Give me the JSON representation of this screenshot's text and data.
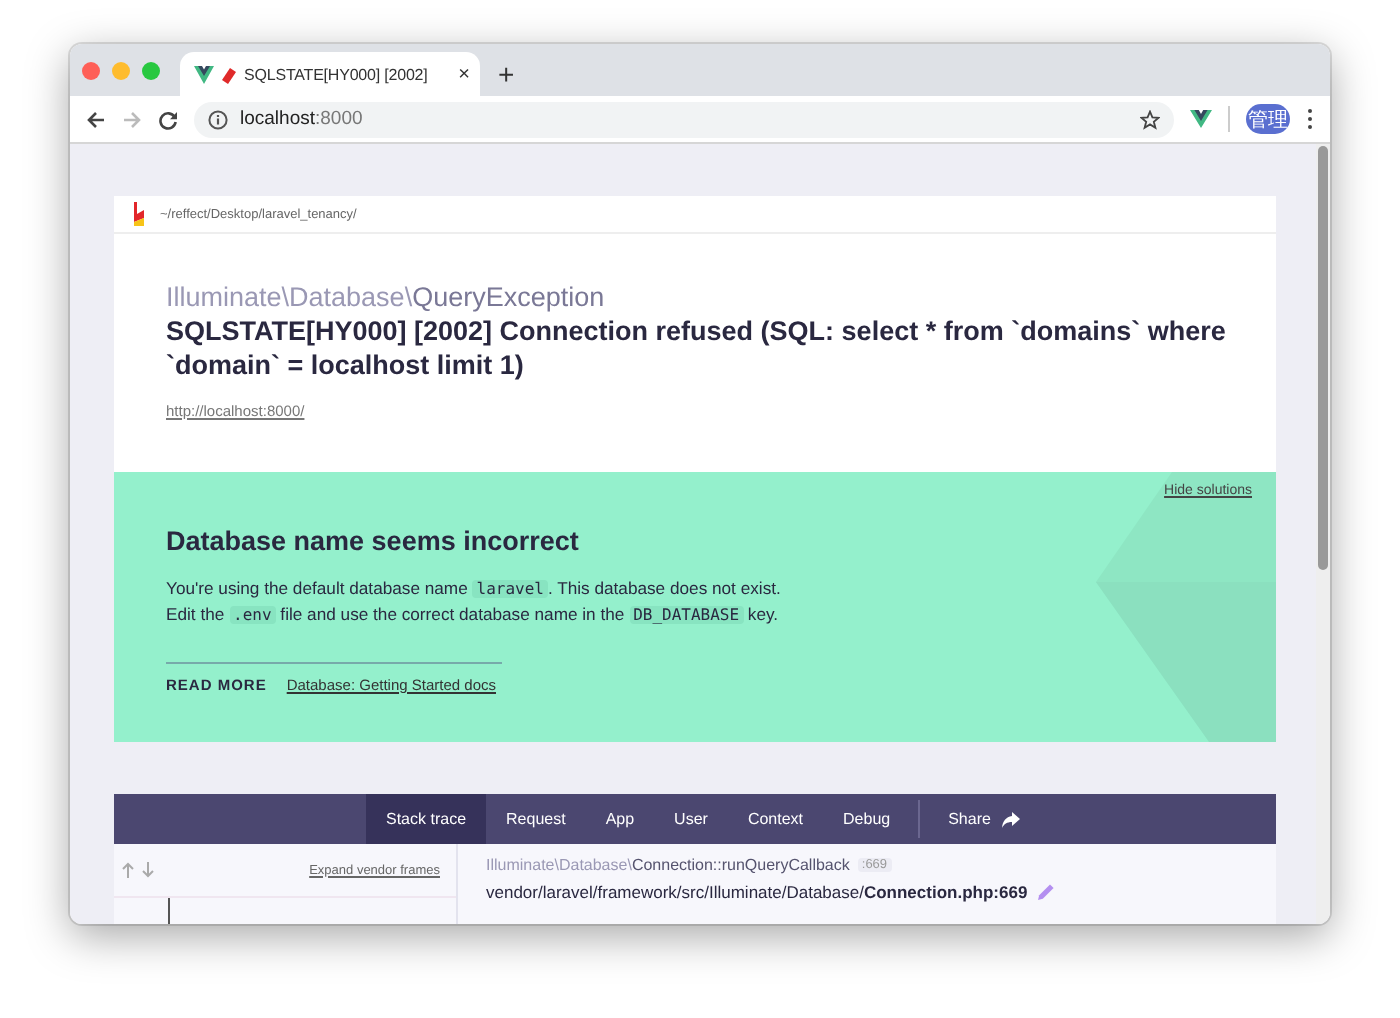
{
  "browser": {
    "tab": {
      "title": "SQLSTATE[HY000] [2002]",
      "close": "×"
    },
    "new_tab": "+",
    "back_disabled": false,
    "forward_disabled": true,
    "address": {
      "host": "localhost",
      "port": ":8000"
    },
    "avatar": "管理"
  },
  "error": {
    "path": "~/reffect/Desktop/laravel_tenancy/",
    "exception": {
      "namespace": "Illuminate\\Database\\",
      "class": "QueryException"
    },
    "message": "SQLSTATE[HY000] [2002] Connection refused (SQL: select * from `domains` where `domain` = localhost limit 1)",
    "url": "http://localhost:8000/"
  },
  "solution": {
    "hide_label": "Hide solutions",
    "title": "Database name seems incorrect",
    "lines": [
      [
        {
          "kind": "text",
          "text": "You're using the default database name "
        },
        {
          "kind": "code",
          "text": "laravel"
        },
        {
          "kind": "text",
          "text": ". This database does not exist."
        }
      ],
      [
        {
          "kind": "text",
          "text": "Edit the "
        },
        {
          "kind": "code",
          "text": ".env"
        },
        {
          "kind": "text",
          "text": " file and use the correct database name in the "
        },
        {
          "kind": "code",
          "text": "DB_DATABASE"
        },
        {
          "kind": "text",
          "text": " key."
        }
      ]
    ],
    "read_more": {
      "label": "READ MORE",
      "links": [
        "Database: Getting Started docs"
      ]
    }
  },
  "trace": {
    "tabs": [
      {
        "label": "Stack trace",
        "kind": "tab",
        "selected": true
      },
      {
        "label": "Request",
        "kind": "tab",
        "selected": false
      },
      {
        "label": "App",
        "kind": "tab",
        "selected": false
      },
      {
        "label": "User",
        "kind": "tab",
        "selected": false
      },
      {
        "label": "Context",
        "kind": "tab",
        "selected": false
      },
      {
        "label": "Debug",
        "kind": "tab",
        "selected": false
      },
      {
        "label": "Share",
        "kind": "share",
        "selected": false
      }
    ],
    "expand_label": "Expand vendor frames",
    "frame": {
      "namespace": "Illuminate\\Database\\",
      "class": "Connection",
      "method": "::runQueryCallback",
      "line": ":669",
      "file": "vendor/laravel/framework/src/Illuminate/Database/**Connection.php:669**"
    }
  }
}
